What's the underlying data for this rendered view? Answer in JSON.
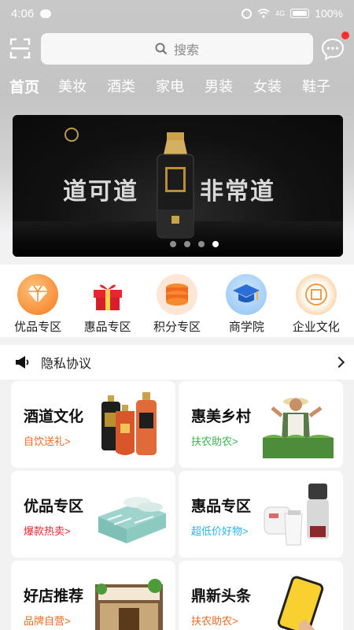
{
  "status_bar": {
    "time": "4:06",
    "battery_text": "100%",
    "signal_text": "4G"
  },
  "search": {
    "placeholder": "搜索"
  },
  "categories": [
    "首页",
    "美妆",
    "酒类",
    "家电",
    "男装",
    "女装",
    "鞋子"
  ],
  "banner": {
    "left_text": "道可道",
    "right_text": "非常道",
    "dots": 4,
    "active_dot": 3
  },
  "quick_entries": [
    {
      "label": "优品专区",
      "icon": "diamond-icon",
      "color": "#f47a20"
    },
    {
      "label": "惠品专区",
      "icon": "gift-icon",
      "color": "#e8262f"
    },
    {
      "label": "积分专区",
      "icon": "coins-icon",
      "color": "#f06a1f"
    },
    {
      "label": "商学院",
      "icon": "graduation-cap-icon",
      "color": "#2d8de5"
    },
    {
      "label": "企业文化",
      "icon": "company-badge-icon",
      "color": "#f29a3c"
    }
  ],
  "notice": {
    "text": "隐私协议",
    "icon": "megaphone-icon"
  },
  "cards": [
    {
      "title": "酒道文化",
      "sub": "自饮送礼>",
      "sub_color": "#f06a1f",
      "image": "liquor-bottles"
    },
    {
      "title": "惠美乡村",
      "sub": "扶农助农>",
      "sub_color": "#3bb54a",
      "image": "farmer-vegetables"
    },
    {
      "title": "优品专区",
      "sub": "爆款热卖>",
      "sub_color": "#e8262f",
      "image": "bedding"
    },
    {
      "title": "惠品专区",
      "sub": "超低价好物>",
      "sub_color": "#2db3e8",
      "image": "appliances"
    },
    {
      "title": "好店推荐",
      "sub": "品牌自营>",
      "sub_color": "#f06a1f",
      "image": "shop-front"
    },
    {
      "title": "鼎新头条",
      "sub": "扶农助农>",
      "sub_color": "#f06a1f",
      "image": "phone-news"
    }
  ]
}
